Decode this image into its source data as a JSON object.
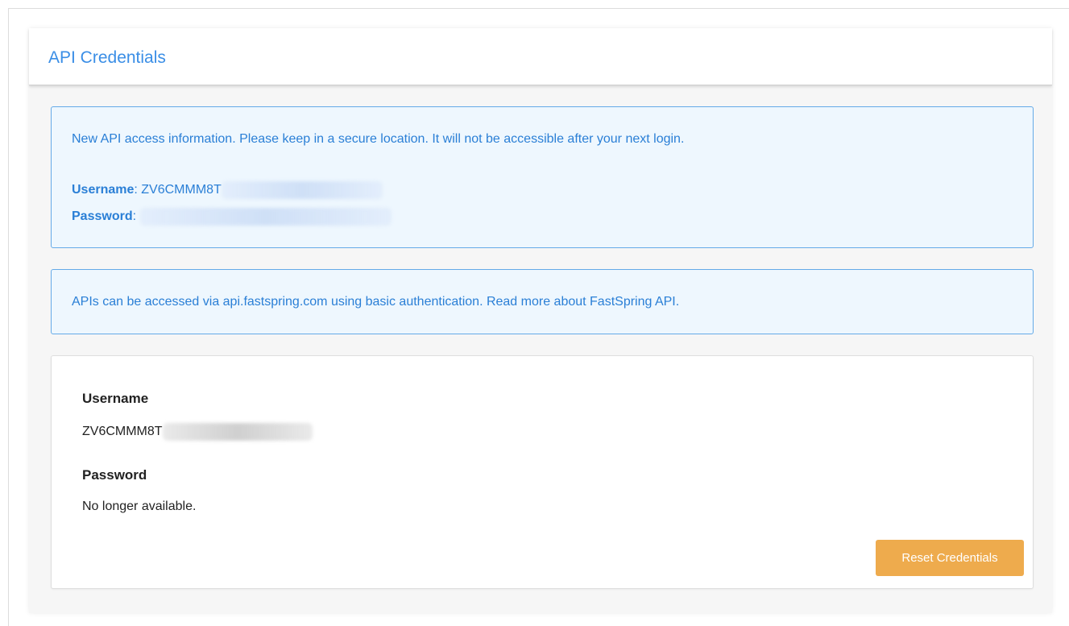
{
  "panel": {
    "title": "API Credentials"
  },
  "new_credentials_alert": {
    "message": "New API access information. Please keep in a secure location. It will not be accessible after your next login.",
    "username_label": "Username",
    "username_value": "ZV6CMMM8T",
    "password_label": "Password",
    "separator": ":"
  },
  "info_alert": {
    "message": "APIs can be accessed via api.fastspring.com using basic authentication. Read more about FastSpring API."
  },
  "credentials_card": {
    "username_label": "Username",
    "username_value": "ZV6CMMM8T",
    "password_label": "Password",
    "password_value": "No longer available.",
    "reset_button_label": "Reset Credentials"
  },
  "colors": {
    "accent_blue": "#3a8ee6",
    "alert_background": "#eef7fe",
    "alert_border": "#64aae8",
    "button_orange": "#eeab4d"
  }
}
